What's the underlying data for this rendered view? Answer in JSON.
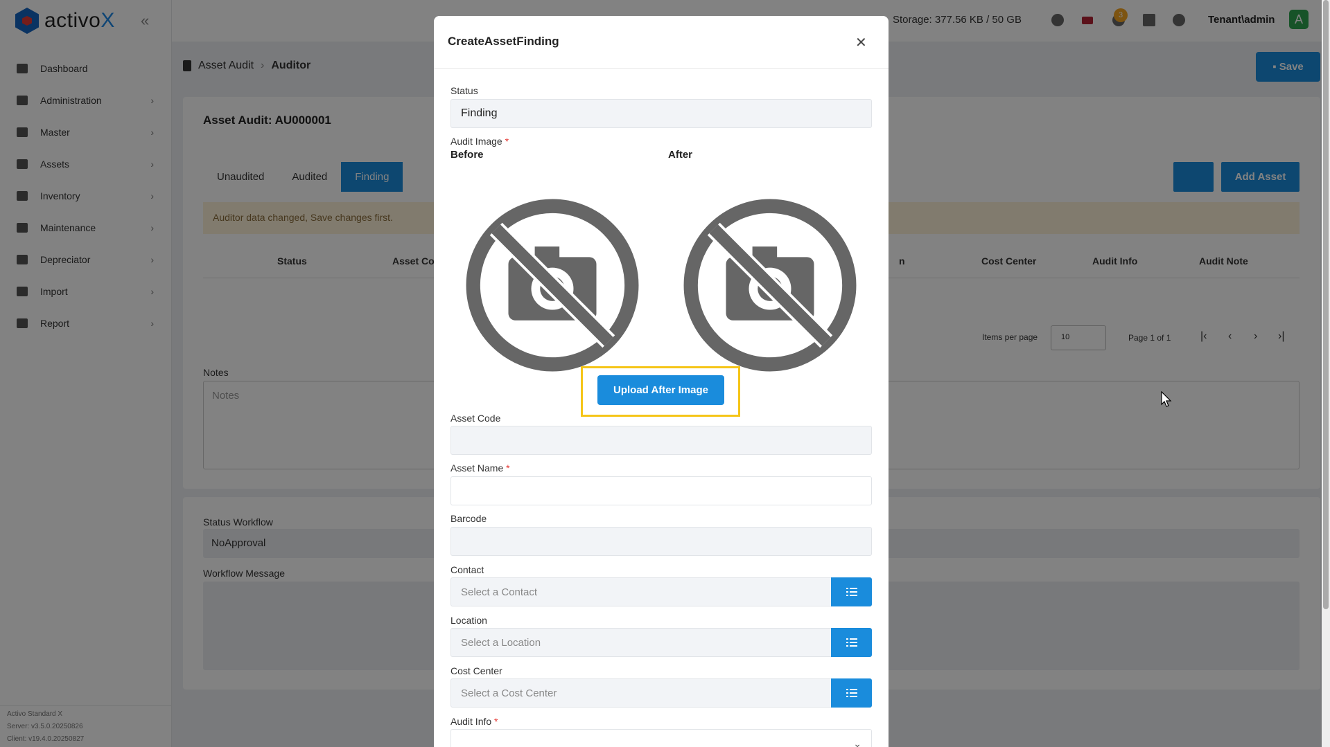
{
  "app": {
    "brand_prefix": "activo",
    "brand_suffix": "X",
    "storage": "Storage: 377.56 KB / 50 GB",
    "notification_count": "3",
    "user": "Tenant\\admin",
    "avatar_letter": "A"
  },
  "sidebar": {
    "items": [
      {
        "label": "Dashboard",
        "icon": "chart-icon"
      },
      {
        "label": "Administration",
        "icon": "gears-icon"
      },
      {
        "label": "Master",
        "icon": "database-icon"
      },
      {
        "label": "Assets",
        "icon": "laptop-icon"
      },
      {
        "label": "Inventory",
        "icon": "warehouse-icon"
      },
      {
        "label": "Maintenance",
        "icon": "tools-icon"
      },
      {
        "label": "Depreciator",
        "icon": "trash-icon"
      },
      {
        "label": "Import",
        "icon": "file-import-icon"
      },
      {
        "label": "Report",
        "icon": "chart-line-icon"
      }
    ],
    "version_lines": [
      "Activo Standard X",
      "Server: v3.5.0.20250826",
      "Client: v19.4.0.20250827"
    ]
  },
  "breadcrumb": {
    "parent": "Asset Audit",
    "current": "Auditor"
  },
  "toolbar": {
    "save_label": "Save"
  },
  "audit": {
    "title": "Asset Audit: AU000001",
    "tabs": [
      "Unaudited",
      "Audited",
      "Finding"
    ],
    "active_tab": "Finding",
    "add_asset_label": "Add Asset",
    "alert": "Auditor data changed, Save changes first.",
    "columns_left": [
      "Status",
      "Asset Co"
    ],
    "columns_right": [
      "n",
      "Cost Center",
      "Audit Info",
      "Audit Note"
    ],
    "items_per_page_label": "Items per page",
    "items_per_page_value": "10",
    "page_info": "Page 1 of 1",
    "notes_label": "Notes",
    "notes_placeholder": "Notes",
    "status_workflow_label": "Status Workflow",
    "status_workflow_value": "NoApproval",
    "workflow_message_label": "Workflow Message"
  },
  "modal": {
    "title": "CreateAssetFinding",
    "status_label": "Status",
    "status_value": "Finding",
    "audit_image_label": "Audit Image",
    "before_label": "Before",
    "after_label": "After",
    "upload_label": "Upload After Image",
    "asset_code_label": "Asset Code",
    "asset_code_value": "",
    "asset_name_label": "Asset Name",
    "asset_name_value": "",
    "barcode_label": "Barcode",
    "barcode_value": "",
    "contact_label": "Contact",
    "contact_placeholder": "Select a Contact",
    "location_label": "Location",
    "location_placeholder": "Select a Location",
    "cost_center_label": "Cost Center",
    "cost_center_placeholder": "Select a Cost Center",
    "audit_info_label": "Audit Info"
  },
  "colors": {
    "primary": "#1a8cdc",
    "highlight": "#f5c518",
    "required": "#e53935",
    "alert_bg": "#fdf1d7"
  }
}
